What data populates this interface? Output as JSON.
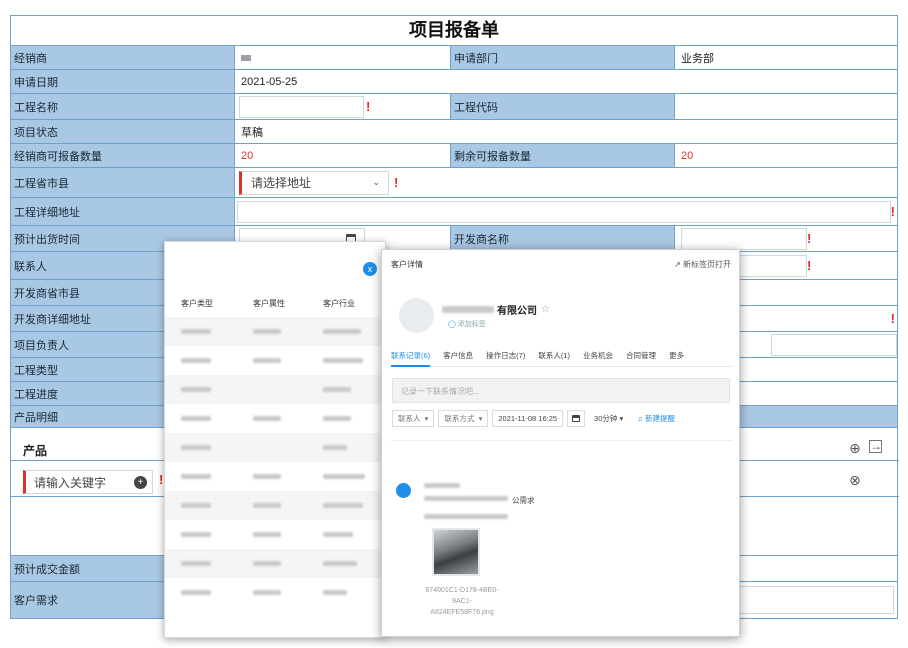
{
  "form": {
    "title": "项目报备单",
    "rows": {
      "dealer_label": "经销商",
      "dept_label": "申请部门",
      "dept_value": "业务部",
      "date_label": "申请日期",
      "date_value": "2021-05-25",
      "proj_name_label": "工程名称",
      "proj_code_label": "工程代码",
      "status_label": "项目状态",
      "status_value": "草稿",
      "quota_label": "经销商可报备数量",
      "quota_value": "20",
      "remain_label": "剩余可报备数量",
      "remain_value": "20",
      "region_label": "工程省市县",
      "region_placeholder": "请选择地址",
      "addr_label": "工程详细地址",
      "ship_label": "预计出货时间",
      "developer_label": "开发商名称",
      "contact_label": "联系人",
      "dev_region_label": "开发商省市县",
      "dev_addr_label": "开发商详细地址",
      "owner_label": "项目负责人",
      "type_label": "工程类型",
      "progress_label": "工程进度",
      "detail_label": "产品明细",
      "product_label": "产品",
      "keyword_placeholder": "请输入关键字",
      "amount_label": "预计成交金额",
      "need_label": "客户需求"
    },
    "required_mark": "!"
  },
  "list_panel": {
    "headers": [
      "客户类型",
      "客户属性",
      "客户行业"
    ],
    "close_icon": "x"
  },
  "detail_panel": {
    "title": "客户详情",
    "open_new_tab": "新标签页打开",
    "company_suffix": "有限公司",
    "add_tag": "添加标签",
    "tabs": [
      "联系记录(6)",
      "客户信息",
      "操作日志(7)",
      "联系人(1)",
      "业务机会",
      "合同管理",
      "更多"
    ],
    "note_placeholder": "记录一下联系情况吧...",
    "controls": {
      "contact": "联系人",
      "method": "联系方式",
      "datetime": "2021-11-08 16:25",
      "duration": "30分钟",
      "new_remind": "新建提醒"
    },
    "record_text": "公需求",
    "file_name": "874001C1-D178-4BE0-9AC1-A824EFE58F76.png"
  },
  "colors": {
    "label_bg": "#a9c8e3",
    "border": "#6ea1cc",
    "required": "#e32b23",
    "accent": "#1f8ee8"
  }
}
